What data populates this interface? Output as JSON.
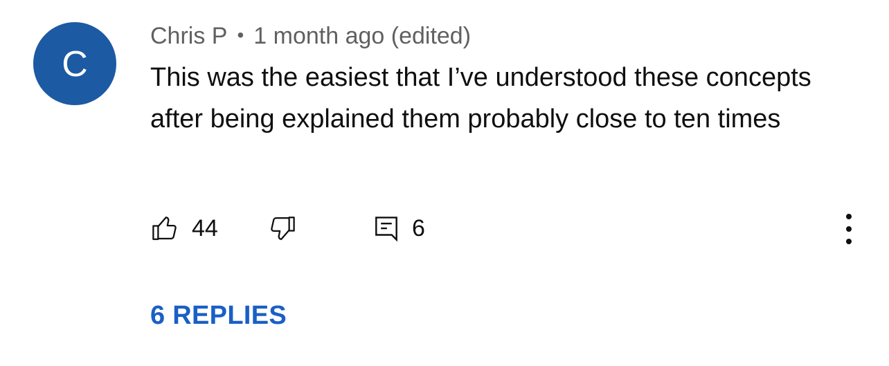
{
  "comment": {
    "avatar_letter": "C",
    "author": "Chris P",
    "separator": "•",
    "time": "1 month ago (edited)",
    "text": "This was the easiest that I’ve understood these concepts after being explained them probably close to ten times"
  },
  "actions": {
    "like_count": "44",
    "reply_count": "6"
  },
  "replies_link": "6 REPLIES",
  "colors": {
    "avatar_bg": "#1c5aa3",
    "link": "#1a5fc6",
    "meta_text": "#606060"
  },
  "icons": {
    "like": "thumbs-up-icon",
    "dislike": "thumbs-down-icon",
    "reply": "comment-icon",
    "menu": "more-vertical-icon"
  }
}
